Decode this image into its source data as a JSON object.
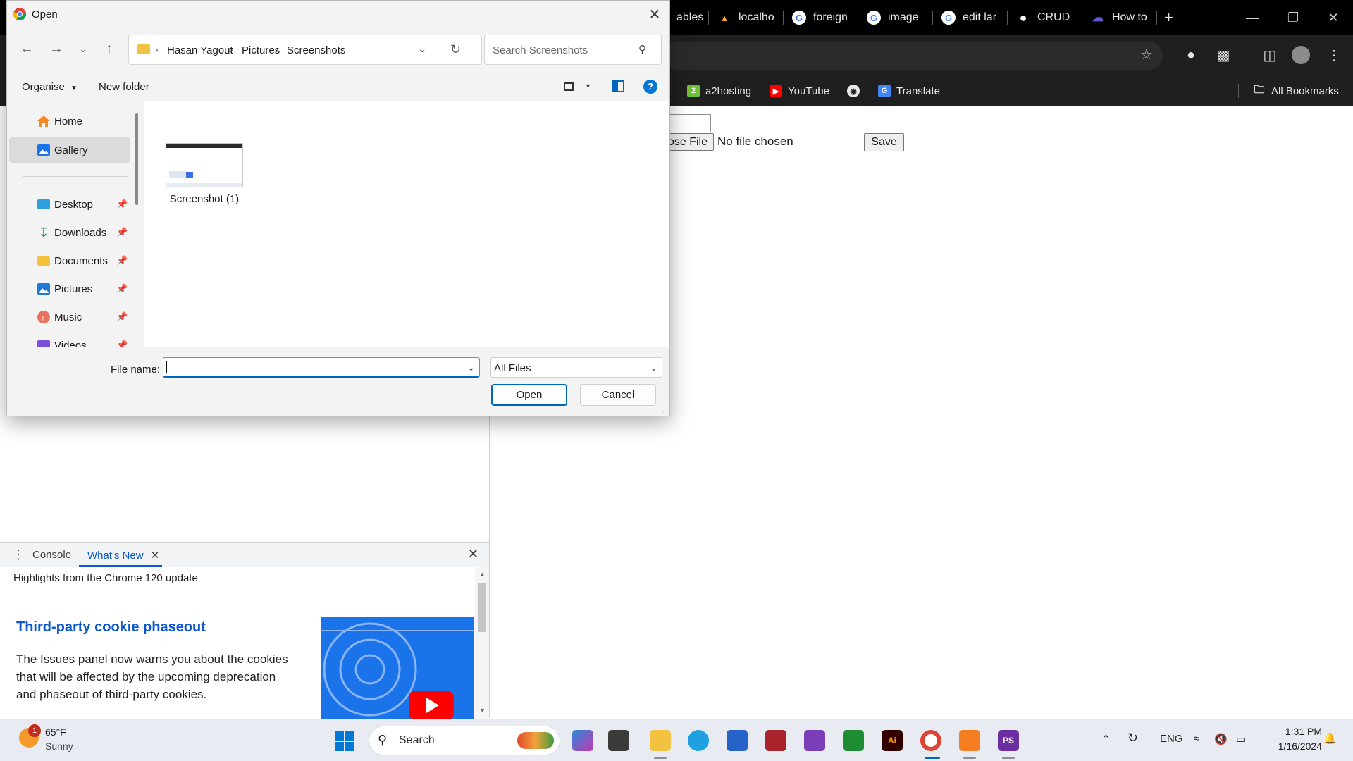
{
  "browser": {
    "tabs": [
      {
        "label": "ables",
        "icon": "table-icon"
      },
      {
        "label": "localho",
        "icon": "xampp-icon"
      },
      {
        "label": "foreign",
        "icon": "google-icon"
      },
      {
        "label": "image",
        "icon": "google-icon"
      },
      {
        "label": "edit lar",
        "icon": "google-icon"
      },
      {
        "label": "CRUD",
        "icon": "medium-icon"
      },
      {
        "label": "How to",
        "icon": "cloud-icon"
      }
    ],
    "new_tab_label": "+",
    "bookmarks": [
      {
        "label": "a2hosting",
        "icon": "a2hosting-icon",
        "color": "#6fbf3a"
      },
      {
        "label": "YouTube",
        "icon": "youtube-icon",
        "color": "#ff0000"
      },
      {
        "label": "",
        "icon": "globe-icon",
        "color": "#e8e8e8"
      },
      {
        "label": "Translate",
        "icon": "translate-icon",
        "color": "#4285f4"
      }
    ],
    "all_bookmarks_label": "All Bookmarks"
  },
  "page": {
    "choose_file_label": "ose File",
    "no_file_text": "No file chosen",
    "save_label": "Save"
  },
  "devtools": {
    "tabs": [
      "Console",
      "What's New"
    ],
    "active_tab": "What's New",
    "highlights": "Highlights from the Chrome 120 update",
    "heading": "Third-party cookie phaseout",
    "body": "The Issues panel now warns you about the cookies that will be affected by the upcoming deprecation and phaseout of third-party cookies."
  },
  "dialog": {
    "title": "Open",
    "breadcrumb": [
      "Hasan Yagout",
      "Pictures",
      "Screenshots"
    ],
    "search_placeholder": "Search Screenshots",
    "organise_label": "Organise",
    "new_folder_label": "New folder",
    "nav_items": [
      {
        "label": "Home",
        "icon": "home-icon",
        "pinned": false
      },
      {
        "label": "Gallery",
        "icon": "gallery-icon",
        "pinned": false,
        "selected": true
      },
      {
        "label": "Desktop",
        "icon": "desktop-icon",
        "pinned": true
      },
      {
        "label": "Downloads",
        "icon": "downloads-icon",
        "pinned": true
      },
      {
        "label": "Documents",
        "icon": "documents-icon",
        "pinned": true
      },
      {
        "label": "Pictures",
        "icon": "pictures-icon",
        "pinned": true
      },
      {
        "label": "Music",
        "icon": "music-icon",
        "pinned": true
      },
      {
        "label": "Videos",
        "icon": "videos-icon",
        "pinned": true
      }
    ],
    "files": [
      {
        "name": "Screenshot (1)"
      }
    ],
    "file_name_label": "File name:",
    "file_name_value": "",
    "file_type": "All Files",
    "open_label": "Open",
    "cancel_label": "Cancel"
  },
  "taskbar": {
    "weather_temp": "65°F",
    "weather_condition": "Sunny",
    "weather_badge": "1",
    "search_label": "Search",
    "tray_lang": "ENG",
    "time": "1:31 PM",
    "date": "1/16/2024"
  }
}
